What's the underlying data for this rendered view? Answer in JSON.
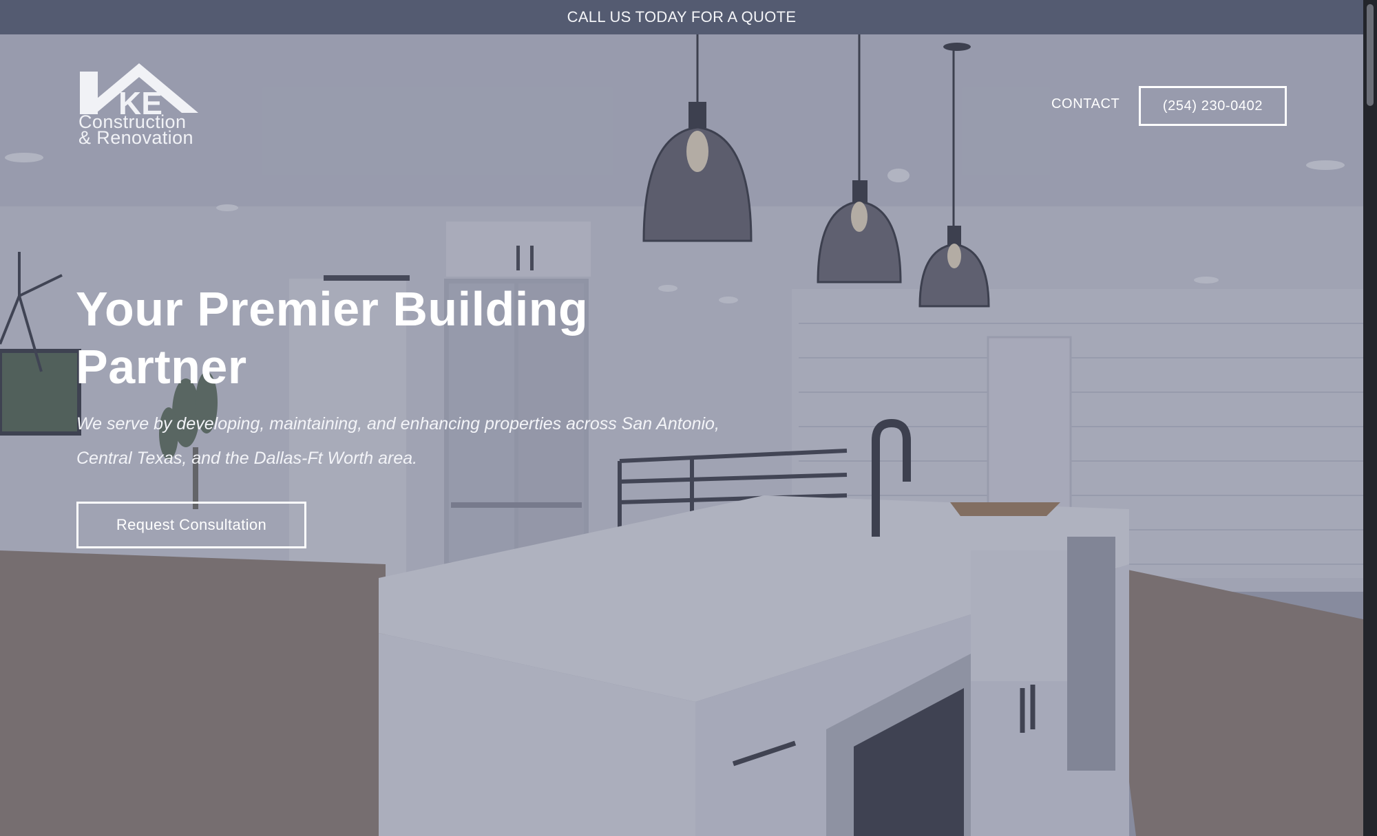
{
  "announcement": {
    "text": "CALL US TODAY FOR A QUOTE"
  },
  "header": {
    "logo": {
      "monogram": "KE",
      "line1": "Construction",
      "line2": "& Renovation"
    },
    "nav": {
      "contact_label": "CONTACT",
      "phone_label": "(254) 230-0402"
    }
  },
  "hero": {
    "headline": "Your Premier Building Partner",
    "subtext": "We serve by developing, maintaining, and enhancing properties across San Antonio, Central Texas, and the Dallas-Ft Worth area.",
    "cta_label": "Request Consultation",
    "background": "kitchen-interior-photo"
  },
  "colors": {
    "topbar": "#545b71",
    "overlay": "#585e78",
    "text": "#ffffff"
  }
}
